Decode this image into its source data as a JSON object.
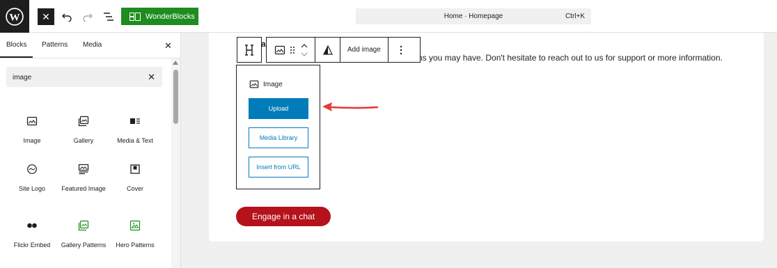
{
  "topbar": {
    "wonderblocks_label": "WonderBlocks",
    "command_title": "Home · Homepage",
    "command_shortcut": "Ctrl+K"
  },
  "sidebar": {
    "tabs": [
      {
        "label": "Blocks",
        "active": true
      },
      {
        "label": "Patterns",
        "active": false
      },
      {
        "label": "Media",
        "active": false
      }
    ],
    "search_value": "image",
    "blocks": [
      {
        "label": "Image",
        "icon": "image-icon"
      },
      {
        "label": "Gallery",
        "icon": "gallery-icon"
      },
      {
        "label": "Media & Text",
        "icon": "media-text-icon"
      },
      {
        "label": "Site Logo",
        "icon": "site-logo-icon"
      },
      {
        "label": "Featured Image",
        "icon": "featured-image-icon"
      },
      {
        "label": "Cover",
        "icon": "cover-icon"
      },
      {
        "label": "Flickr Embed",
        "icon": "flickr-icon"
      },
      {
        "label": "Gallery Patterns",
        "icon": "gallery-patterns-icon"
      },
      {
        "label": "Hero Patterns",
        "icon": "hero-patterns-icon"
      }
    ]
  },
  "canvas": {
    "heading_fragment": "a",
    "paragraph_fragment": "rns you may have. Don't hesitate to reach out to us for support or more information.",
    "toolbar": {
      "add_image_label": "Add image"
    },
    "placeholder": {
      "title": "Image",
      "upload_label": "Upload",
      "media_library_label": "Media Library",
      "insert_url_label": "Insert from URL"
    },
    "chat_button_label": "Engage in a chat"
  },
  "colors": {
    "accent_blue": "#007cba",
    "wonderblocks_green": "#1e8c1e",
    "chat_red": "#b5121b",
    "arrow_red": "#e53935"
  }
}
